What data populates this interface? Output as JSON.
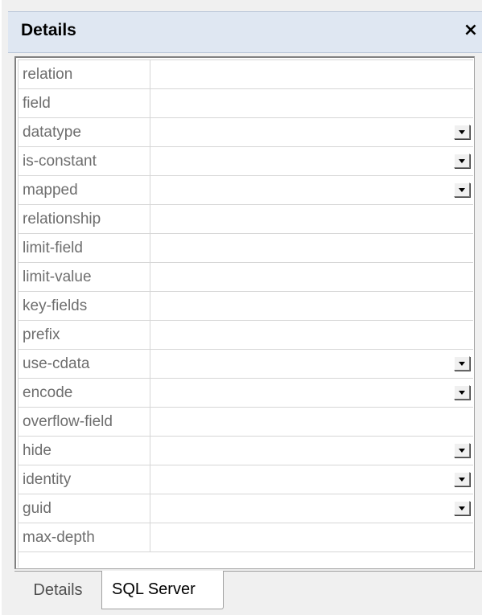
{
  "panel": {
    "title": "Details",
    "close_glyph": "×"
  },
  "properties": [
    {
      "name": "relation",
      "has_dropdown": false
    },
    {
      "name": "field",
      "has_dropdown": false
    },
    {
      "name": "datatype",
      "has_dropdown": true
    },
    {
      "name": "is-constant",
      "has_dropdown": true
    },
    {
      "name": "mapped",
      "has_dropdown": true
    },
    {
      "name": "relationship",
      "has_dropdown": false
    },
    {
      "name": "limit-field",
      "has_dropdown": false
    },
    {
      "name": "limit-value",
      "has_dropdown": false
    },
    {
      "name": "key-fields",
      "has_dropdown": false
    },
    {
      "name": "prefix",
      "has_dropdown": false
    },
    {
      "name": "use-cdata",
      "has_dropdown": true
    },
    {
      "name": "encode",
      "has_dropdown": true
    },
    {
      "name": "overflow-field",
      "has_dropdown": false
    },
    {
      "name": "hide",
      "has_dropdown": true
    },
    {
      "name": "identity",
      "has_dropdown": true
    },
    {
      "name": "guid",
      "has_dropdown": true
    },
    {
      "name": "max-depth",
      "has_dropdown": false
    }
  ],
  "tabs": [
    {
      "label": "Details",
      "active": false
    },
    {
      "label": "SQL Server",
      "active": true
    }
  ],
  "icons": {
    "close": "close-icon",
    "dropdown": "chevron-down-icon"
  }
}
